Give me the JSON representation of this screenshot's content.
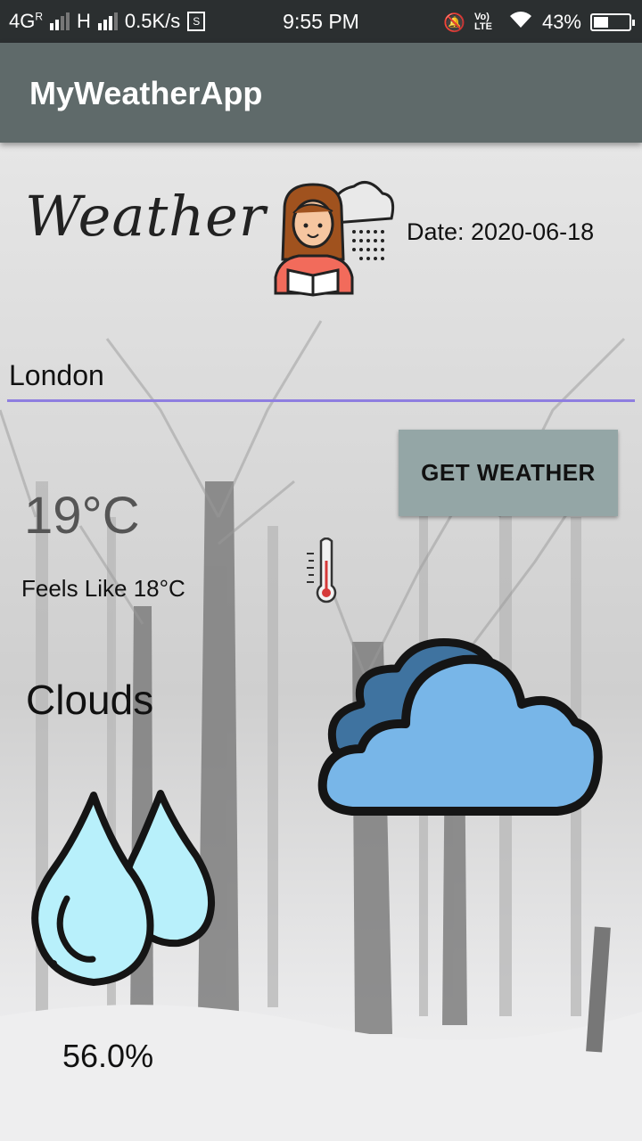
{
  "status_bar": {
    "network": "4G",
    "network_sup": "R",
    "network2": "H",
    "speed": "0.5K/s",
    "time": "9:55 PM",
    "volte": "Vo) LTE",
    "battery": "43%",
    "battery_level": 0.43
  },
  "app_bar": {
    "title": "MyWeatherApp"
  },
  "header": {
    "script_title": "Weather",
    "date": "Date: 2020-06-18"
  },
  "search": {
    "city_value": "London"
  },
  "actions": {
    "get_weather_label": "GET WEATHER"
  },
  "current": {
    "temperature": "19°C",
    "feels_like": "Feels Like 18°C",
    "condition": "Clouds",
    "humidity": "56.0%"
  },
  "icons": {
    "reader": "girl-reading-rain-icon",
    "thermometer": "thermometer-icon",
    "clouds": "clouds-icon",
    "humidity": "water-drops-icon"
  },
  "colors": {
    "app_bar": "#5f6a6a",
    "accent_underline": "#8e7ee0",
    "button": "#94a6a6",
    "cloud_front": "#78b6e8",
    "cloud_back": "#3f73a0",
    "drop": "#b8f0fb"
  }
}
